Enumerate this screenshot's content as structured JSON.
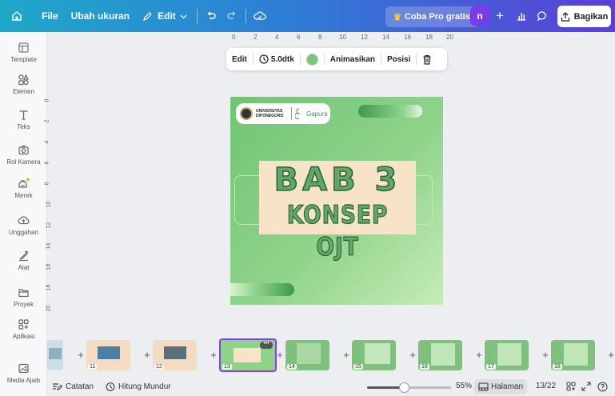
{
  "topbar": {
    "file": "File",
    "resize": "Ubah ukuran",
    "edit": "Edit",
    "pro": "Coba Pro gratis",
    "avatar_initial": "n",
    "share": "Bagikan"
  },
  "sidebar": {
    "items": [
      {
        "label": "Template",
        "icon": "template-icon"
      },
      {
        "label": "Elemen",
        "icon": "elements-icon"
      },
      {
        "label": "Teks",
        "icon": "text-icon"
      },
      {
        "label": "Rol Kamera",
        "icon": "camera-icon"
      },
      {
        "label": "Merek",
        "icon": "brand-icon"
      },
      {
        "label": "Unggahan",
        "icon": "upload-icon"
      },
      {
        "label": "Alat",
        "icon": "tools-icon"
      },
      {
        "label": "Proyek",
        "icon": "folder-icon"
      },
      {
        "label": "Aplikasi",
        "icon": "apps-icon"
      },
      {
        "label": "Media Ajaib",
        "icon": "magic-media-icon"
      }
    ]
  },
  "ruler": {
    "top": [
      "0",
      "2",
      "4",
      "6",
      "8",
      "10",
      "12",
      "14",
      "16",
      "18",
      "20"
    ],
    "left": [
      "0",
      "2",
      "4",
      "6",
      "8",
      "10",
      "12",
      "14",
      "16",
      "18",
      "20"
    ]
  },
  "context_toolbar": {
    "edit": "Edit",
    "duration": "5.0dtk",
    "animate": "Animasikan",
    "position": "Posisi"
  },
  "slide": {
    "university": "UNIVERSITAS DIPONEGORO",
    "program": "Gapura",
    "title_line1": "BAB 3",
    "title_line2": "KONSEP OJT",
    "background_color": "#8fd38b"
  },
  "filmstrip": {
    "pages": [
      "11",
      "12",
      "13",
      "14",
      "15",
      "16",
      "17",
      "18"
    ],
    "selected": "13"
  },
  "bottombar": {
    "notes": "Catatan",
    "timer": "Hitung Mundur",
    "zoom": "55%",
    "pages_label": "Halaman",
    "page_count": "13/22"
  }
}
